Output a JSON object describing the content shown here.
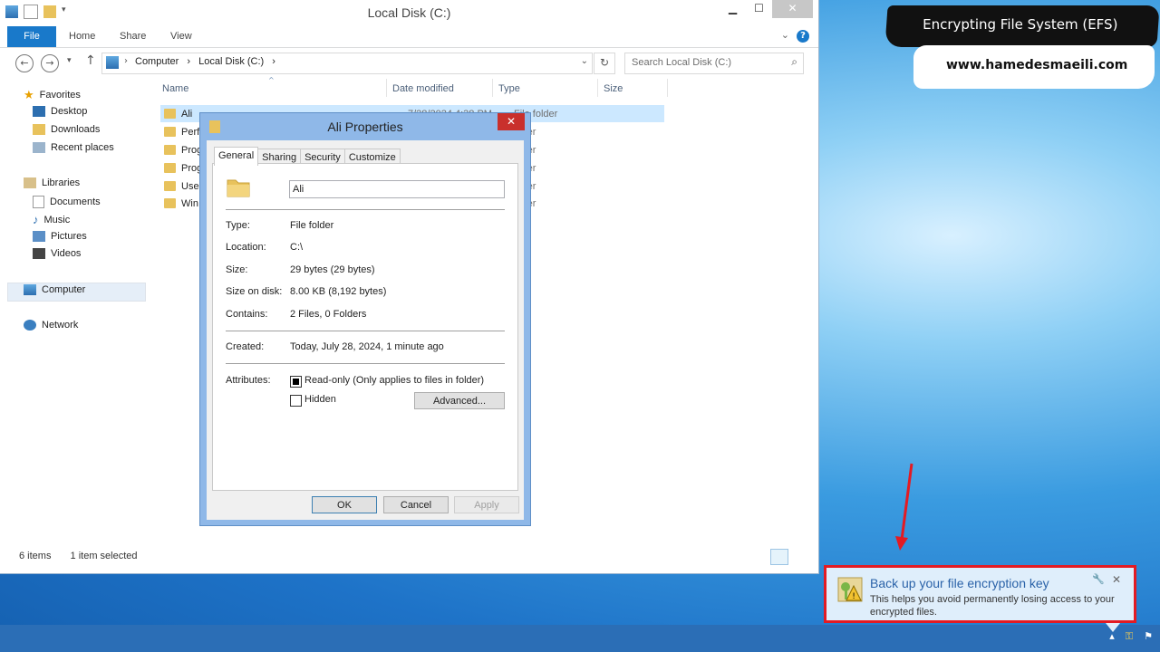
{
  "explorer": {
    "title": "Local Disk (C:)",
    "ribbon_tabs": [
      "File",
      "Home",
      "Share",
      "View"
    ],
    "breadcrumb": [
      "Computer",
      "Local Disk (C:)"
    ],
    "search_placeholder": "Search Local Disk (C:)",
    "columns": [
      "Name",
      "Date modified",
      "Type",
      "Size"
    ],
    "files": [
      {
        "name": "Ali",
        "date": "7/28/2024 4:38 PM",
        "type": "File folder",
        "selected": true
      },
      {
        "name": "Perf",
        "date": "",
        "type": "older"
      },
      {
        "name": "Prog",
        "date": "",
        "type": "older"
      },
      {
        "name": "Prog",
        "date": "",
        "type": "older"
      },
      {
        "name": "Use",
        "date": "",
        "type": "older"
      },
      {
        "name": "Win",
        "date": "",
        "type": "older"
      }
    ],
    "nav": {
      "favorites": "Favorites",
      "desktop": "Desktop",
      "downloads": "Downloads",
      "recent": "Recent places",
      "libraries": "Libraries",
      "documents": "Documents",
      "music": "Music",
      "pictures": "Pictures",
      "videos": "Videos",
      "computer": "Computer",
      "network": "Network"
    },
    "status_items": "6 items",
    "status_selected": "1 item selected"
  },
  "dialog": {
    "title": "Ali Properties",
    "tabs": [
      "General",
      "Sharing",
      "Security",
      "Customize"
    ],
    "name_value": "Ali",
    "labels": {
      "type": "Type:",
      "location": "Location:",
      "size": "Size:",
      "size_on_disk": "Size on disk:",
      "contains": "Contains:",
      "created": "Created:",
      "attributes": "Attributes:"
    },
    "values": {
      "type": "File folder",
      "location": "C:\\",
      "size": "29 bytes (29 bytes)",
      "size_on_disk": "8.00 KB (8,192 bytes)",
      "contains": "2 Files, 0 Folders",
      "created": "Today, July 28, 2024, 1 minute ago"
    },
    "readonly_label": "Read-only (Only applies to files in folder)",
    "hidden_label": "Hidden",
    "advanced_label": "Advanced...",
    "ok_label": "OK",
    "cancel_label": "Cancel",
    "apply_label": "Apply"
  },
  "banner": {
    "title": "Encrypting File System (EFS)",
    "url": "www.hamedesmaeili.com"
  },
  "toast": {
    "title": "Back up your file encryption key",
    "message": "This helps you avoid permanently losing access to your encrypted files."
  },
  "colors": {
    "accent": "#1979ca",
    "highlight_border": "#e31b23",
    "dialog_frame": "#8fb8e8"
  }
}
